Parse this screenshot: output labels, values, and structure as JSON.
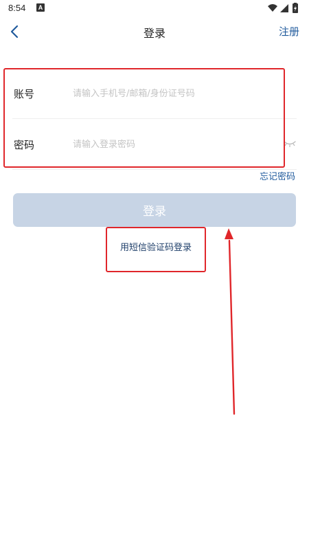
{
  "status_bar": {
    "time": "8:54",
    "notification_letter": "A"
  },
  "nav": {
    "title": "登录",
    "register": "注册"
  },
  "form": {
    "account_label": "账号",
    "account_placeholder": "请输入手机号/邮箱/身份证号码",
    "account_value": "",
    "password_label": "密码",
    "password_placeholder": "请输入登录密码",
    "password_value": "",
    "forgot_password": "忘记密码"
  },
  "actions": {
    "login_button": "登录",
    "sms_login": "用短信验证码登录"
  },
  "icons": {
    "back": "chevron-left-icon",
    "password_visibility": "eye-closed-icon",
    "wifi": "wifi-icon",
    "signal": "signal-icon",
    "battery": "battery-icon"
  },
  "colors": {
    "accent": "#1f5a9c",
    "login_button_disabled": "#c7d4e5",
    "annotation": "#e0262a"
  }
}
